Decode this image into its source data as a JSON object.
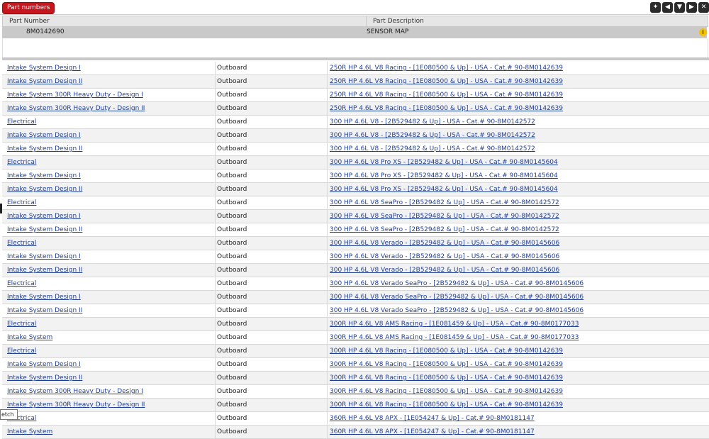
{
  "toolbar": {
    "part_numbers_label": "Part numbers",
    "icons": [
      "pin-icon",
      "previous-icon",
      "filter-icon",
      "next-icon",
      "close-icon"
    ]
  },
  "part_table": {
    "header_part_number": "Part Number",
    "header_part_description": "Part Description",
    "part_number": "8M0142690",
    "part_description": "SENSOR MAP"
  },
  "tooltip": "etch",
  "rows": [
    {
      "system": "Intake System Design I",
      "type": "Outboard",
      "model": "250R HP 4.6L V8 Racing - [1E080500 & Up] - USA - Cat.# 90-8M0142639"
    },
    {
      "system": "Intake System Design II",
      "type": "Outboard",
      "model": "250R HP 4.6L V8 Racing - [1E080500 & Up] - USA - Cat.# 90-8M0142639"
    },
    {
      "system": "Intake System 300R Heavy Duty - Design I",
      "type": "Outboard",
      "model": "250R HP 4.6L V8 Racing - [1E080500 & Up] - USA - Cat.# 90-8M0142639"
    },
    {
      "system": "Intake System 300R Heavy Duty - Design II",
      "type": "Outboard",
      "model": "250R HP 4.6L V8 Racing - [1E080500 & Up] - USA - Cat.# 90-8M0142639"
    },
    {
      "system": "Electrical",
      "type": "Outboard",
      "model": "300 HP 4.6L V8 - [2B529482 & Up] - USA - Cat.# 90-8M0142572"
    },
    {
      "system": "Intake System Design I",
      "type": "Outboard",
      "model": "300 HP 4.6L V8 - [2B529482 & Up] - USA - Cat.# 90-8M0142572"
    },
    {
      "system": "Intake System Design II",
      "type": "Outboard",
      "model": "300 HP 4.6L V8 - [2B529482 & Up] - USA - Cat.# 90-8M0142572"
    },
    {
      "system": "Electrical",
      "type": "Outboard",
      "model": "300 HP 4.6L V8 Pro XS - [2B529482 & Up] - USA - Cat.# 90-8M0145604"
    },
    {
      "system": "Intake System Design I",
      "type": "Outboard",
      "model": "300 HP 4.6L V8 Pro XS - [2B529482 & Up] - USA - Cat.# 90-8M0145604"
    },
    {
      "system": "Intake System Design II",
      "type": "Outboard",
      "model": "300 HP 4.6L V8 Pro XS - [2B529482 & Up] - USA - Cat.# 90-8M0145604"
    },
    {
      "system": "Electrical",
      "type": "Outboard",
      "model": "300 HP 4.6L V8 SeaPro - [2B529482 & Up] - USA - Cat.# 90-8M0142572"
    },
    {
      "system": "Intake System Design I",
      "type": "Outboard",
      "model": "300 HP 4.6L V8 SeaPro - [2B529482 & Up] - USA - Cat.# 90-8M0142572"
    },
    {
      "system": "Intake System Design II",
      "type": "Outboard",
      "model": "300 HP 4.6L V8 SeaPro - [2B529482 & Up] - USA - Cat.# 90-8M0142572"
    },
    {
      "system": "Electrical",
      "type": "Outboard",
      "model": "300 HP 4.6L V8 Verado - [2B529482 & Up] - USA - Cat.# 90-8M0145606"
    },
    {
      "system": "Intake System Design I",
      "type": "Outboard",
      "model": "300 HP 4.6L V8 Verado - [2B529482 & Up] - USA - Cat.# 90-8M0145606"
    },
    {
      "system": "Intake System Design II",
      "type": "Outboard",
      "model": "300 HP 4.6L V8 Verado - [2B529482 & Up] - USA - Cat.# 90-8M0145606"
    },
    {
      "system": "Electrical",
      "type": "Outboard",
      "model": "300 HP 4.6L V8 Verado SeaPro - [2B529482 & Up] - USA - Cat.# 90-8M0145606"
    },
    {
      "system": "Intake System Design I",
      "type": "Outboard",
      "model": "300 HP 4.6L V8 Verado SeaPro - [2B529482 & Up] - USA - Cat.# 90-8M0145606"
    },
    {
      "system": "Intake System Design II",
      "type": "Outboard",
      "model": "300 HP 4.6L V8 Verado SeaPro - [2B529482 & Up] - USA - Cat.# 90-8M0145606"
    },
    {
      "system": "Electrical",
      "type": "Outboard",
      "model": "300R HP 4.6L V8 AMS Racing - [1E081459 & Up] - USA - Cat.# 90-8M0177033"
    },
    {
      "system": "Intake System",
      "type": "Outboard",
      "model": "300R HP 4.6L V8 AMS Racing - [1E081459 & Up] - USA - Cat.# 90-8M0177033"
    },
    {
      "system": "Electrical",
      "type": "Outboard",
      "model": "300R HP 4.6L V8 Racing - [1E080500 & Up] - USA - Cat.# 90-8M0142639"
    },
    {
      "system": "Intake System Design I",
      "type": "Outboard",
      "model": "300R HP 4.6L V8 Racing - [1E080500 & Up] - USA - Cat.# 90-8M0142639"
    },
    {
      "system": "Intake System Design II",
      "type": "Outboard",
      "model": "300R HP 4.6L V8 Racing - [1E080500 & Up] - USA - Cat.# 90-8M0142639"
    },
    {
      "system": "Intake System 300R Heavy Duty - Design I",
      "type": "Outboard",
      "model": "300R HP 4.6L V8 Racing - [1E080500 & Up] - USA - Cat.# 90-8M0142639"
    },
    {
      "system": "Intake System 300R Heavy Duty - Design II",
      "type": "Outboard",
      "model": "300R HP 4.6L V8 Racing - [1E080500 & Up] - USA - Cat.# 90-8M0142639"
    },
    {
      "system": "Electrical",
      "type": "Outboard",
      "model": "360R HP 4.6L V8 APX - [1E054247 & Up] - Cat.# 90-8M0181147"
    },
    {
      "system": "Intake System",
      "type": "Outboard",
      "model": "360R HP 4.6L V8 APX - [1E054247 & Up] - Cat.# 90-8M0181147"
    }
  ]
}
